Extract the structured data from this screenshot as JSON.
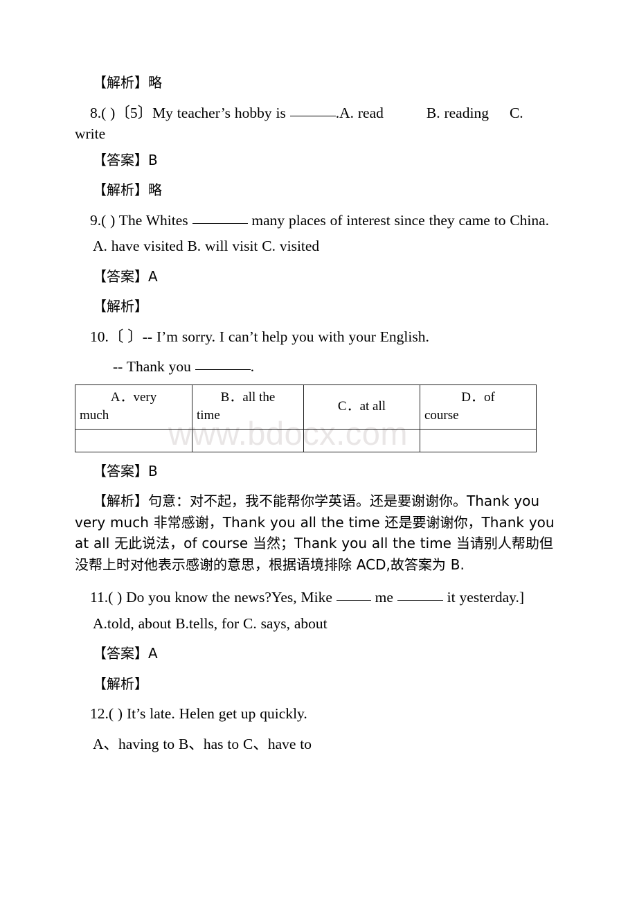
{
  "document": {
    "watermark": "www.bdocx.com",
    "lines": {
      "analysis_skip_1": "【解析】略",
      "q8_text": "8.(    )〔5〕My teacher’s hobby is ",
      "q8_after_blank": ".A. read",
      "q8_opt_b": "B. reading",
      "q8_opt_c": "C. write",
      "q8_answer": "【答案】B",
      "analysis_skip_2": "【解析】略",
      "q9_text": "9.(    ) The Whites ",
      "q9_after_blank": " many places of interest since they came to China.",
      "q9_options": "A. have visited     B. will visit        C. visited",
      "q9_answer": "【答案】A",
      "q9_analysis": "【解析】",
      "q10_text": "10.〔  〕-- I’m sorry. I can’t help you with your English.",
      "q10_line2": "-- Thank you ",
      "q10_line2_end": ".",
      "q10_answer": "【答案】B",
      "q10_analysis": "【解析】句意：对不起，我不能帮你学英语。还是要谢谢你。Thank you very much 非常感谢，Thank you all the time 还是要谢谢你，Thank you at all 无此说法，of course 当然；Thank you all the time 当请别人帮助但没帮上时对他表示感谢的意思，根据语境排除 ACD,故答案为 B.",
      "q11_text": "11.(     ) Do you know the news?Yes, Mike ",
      "q11_mid": " me ",
      "q11_end": " it yesterday.]",
      "q11_options": "A.told, about   B.tells, for     C. says, about",
      "q11_answer": "【答案】A",
      "q11_analysis": "【解析】",
      "q12_text": "12.(    ) It’s late. Helen      get up quickly.",
      "q12_options": "A、having to      B、has to       C、have to"
    },
    "q10_table": {
      "columns": [
        {
          "lead": "A．very",
          "rest": "much"
        },
        {
          "lead": "B．all the",
          "rest": "time"
        },
        {
          "lead": "C．at all",
          "rest": ""
        },
        {
          "lead": "D．of",
          "rest": "course"
        }
      ],
      "empty_row_cells": [
        "",
        "",
        "",
        ""
      ]
    }
  }
}
